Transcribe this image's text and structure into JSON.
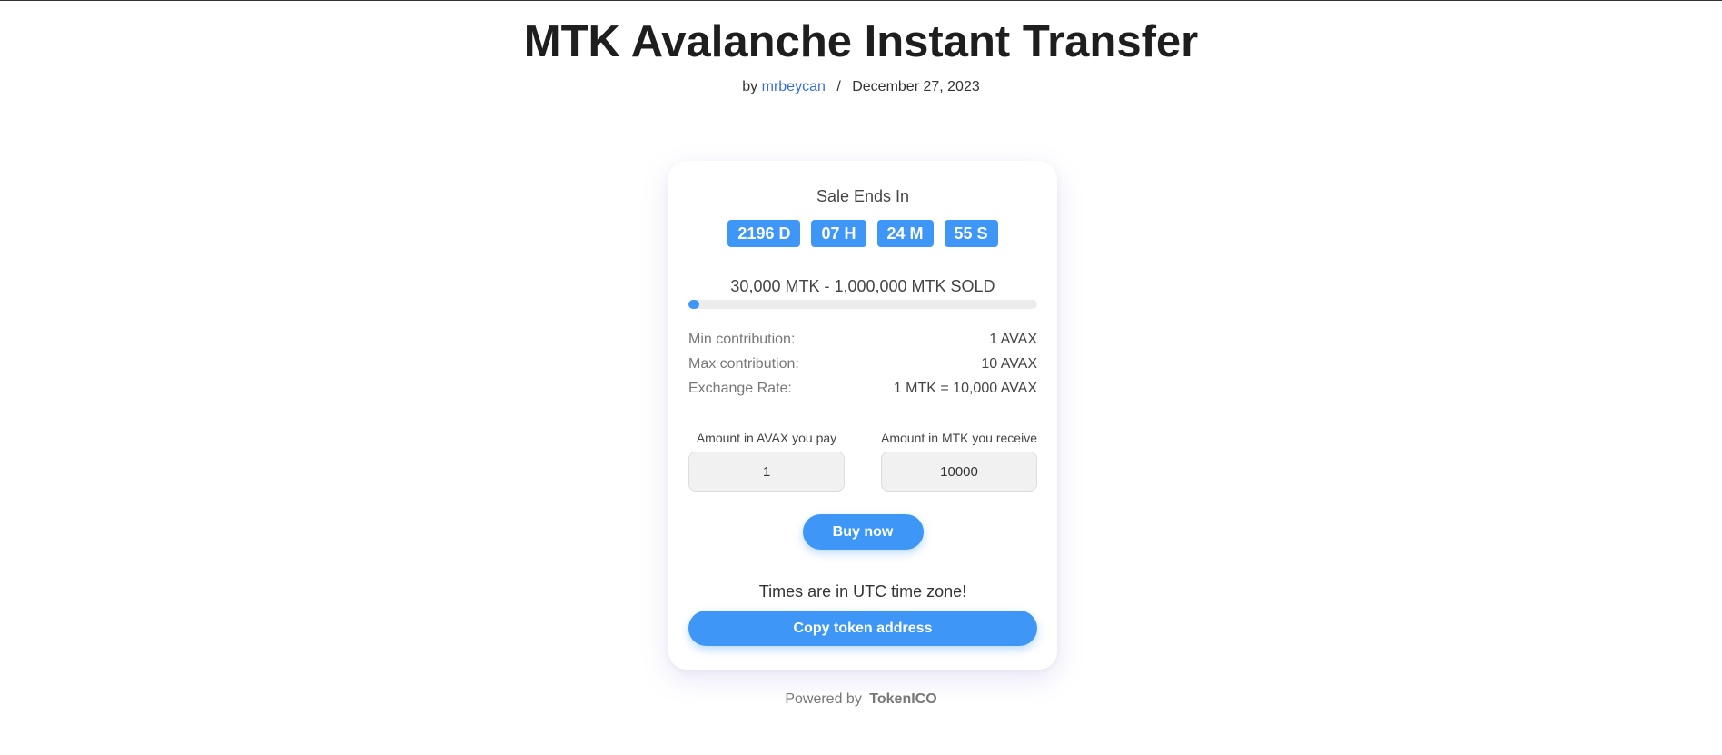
{
  "page": {
    "title": "MTK Avalanche Instant Transfer",
    "by_label": "by",
    "author": "mrbeycan",
    "separator": "/",
    "date": "December 27, 2023"
  },
  "sale": {
    "ends_label": "Sale Ends In",
    "countdown": {
      "days": "2196 D",
      "hours": "07 H",
      "minutes": "24 M",
      "seconds": "55 S"
    },
    "sold_text": "30,000 MTK - 1,000,000 MTK SOLD",
    "progress_fraction": 0.03,
    "accent_color": "#3e96f6"
  },
  "info": [
    {
      "key": "Min contribution:",
      "value": "1 AVAX"
    },
    {
      "key": "Max contribution:",
      "value": "10 AVAX"
    },
    {
      "key": "Exchange Rate:",
      "value": "1 MTK = 10,000 AVAX"
    }
  ],
  "amounts": {
    "pay_label": "Amount in AVAX you pay",
    "pay_value": "1",
    "receive_label": "Amount in MTK you receive",
    "receive_value": "10000"
  },
  "buttons": {
    "buy": "Buy now",
    "copy": "Copy token address"
  },
  "tz_note": "Times are in UTC time zone!",
  "footer": {
    "powered_by": "Powered by",
    "brand": "TokenICO"
  }
}
